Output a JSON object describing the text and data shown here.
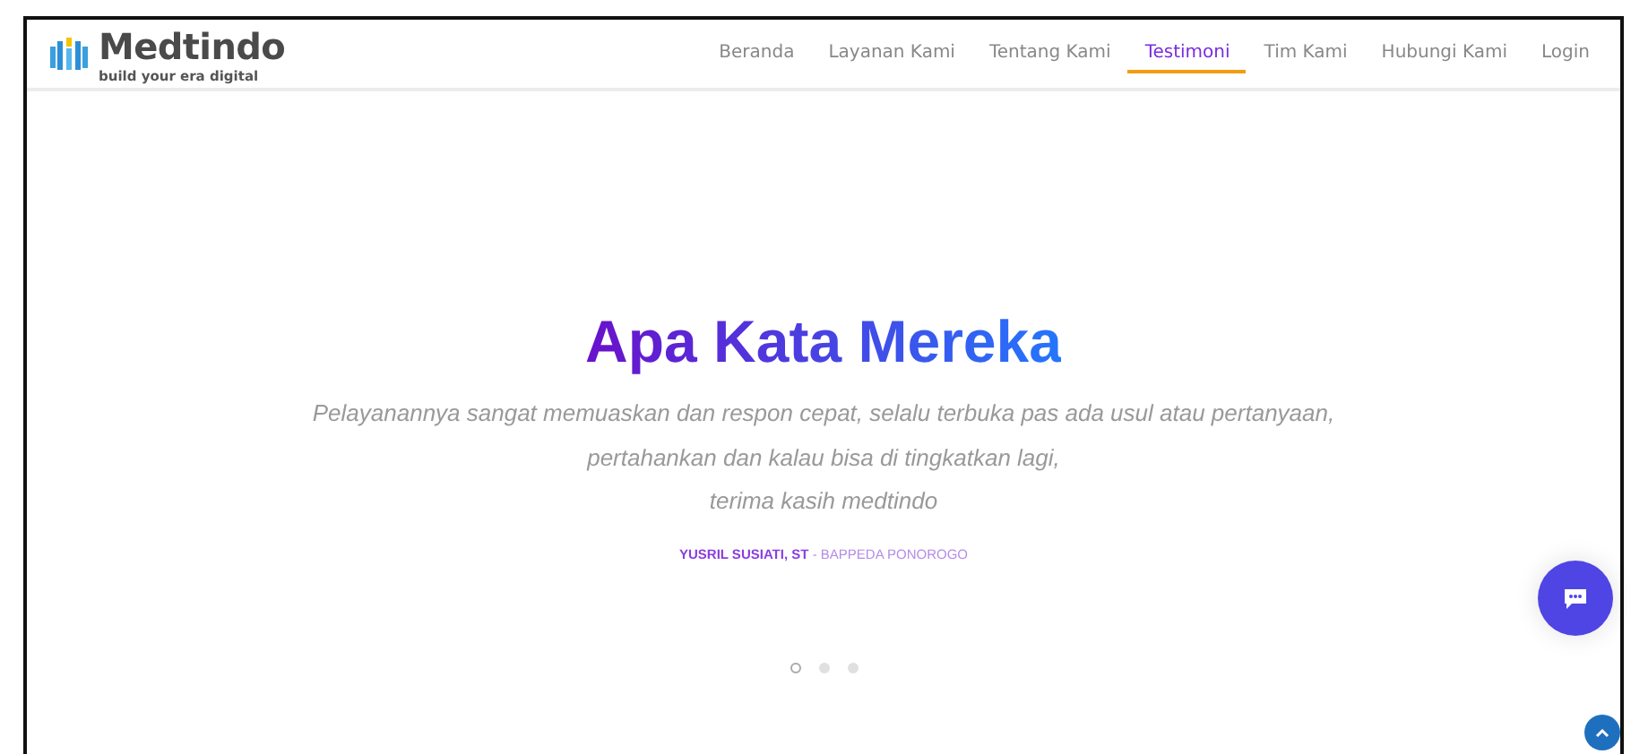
{
  "brand": {
    "name": "Medtindo",
    "tagline": "build your era digital"
  },
  "nav": [
    {
      "label": "Beranda",
      "selected": false
    },
    {
      "label": "Layanan Kami",
      "selected": false
    },
    {
      "label": "Tentang Kami",
      "selected": false
    },
    {
      "label": "Testimoni",
      "selected": true
    },
    {
      "label": "Tim Kami",
      "selected": false
    },
    {
      "label": "Hubungi Kami",
      "selected": false
    },
    {
      "label": "Login",
      "selected": false
    }
  ],
  "testimonial": {
    "heading": "Apa Kata Mereka",
    "quote_lines": [
      "Pelayanannya sangat memuaskan dan respon cepat, selalu terbuka pas ada usul atau pertanyaan,",
      "pertahankan dan kalau bisa di tingkatkan lagi,",
      "terima kasih medtindo"
    ],
    "author": "YUSRIL SUSIATI, ST",
    "organization": "- BAPPEDA PONOROGO"
  },
  "slider_dots": [
    {
      "selected": true
    },
    {
      "selected": false
    },
    {
      "selected": false
    }
  ]
}
